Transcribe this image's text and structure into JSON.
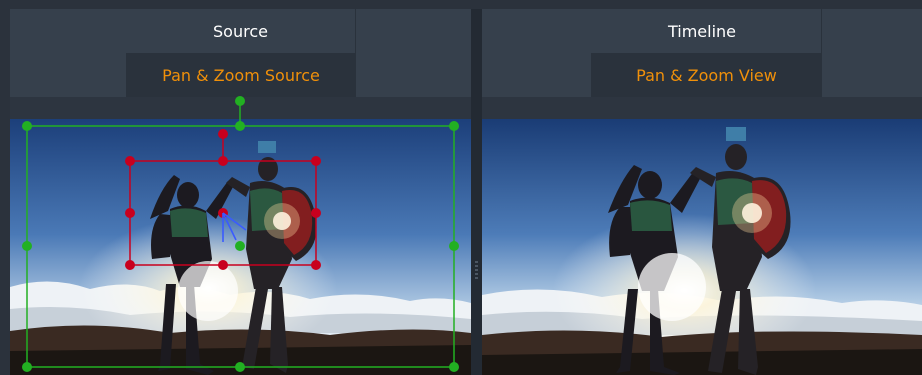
{
  "source_panel": {
    "title": "Source",
    "tab_label": "Pan & Zoom Source"
  },
  "timeline_panel": {
    "title": "Timeline",
    "tab_label": "Pan & Zoom View"
  },
  "colors": {
    "tab_text": "#f0900a",
    "source_frame": "#22b022",
    "zoom_frame": "#c8001e",
    "motion_arrow": "#3a5bff",
    "panel_bg": "#36404c"
  },
  "icons": [
    "source-frame-handle",
    "zoom-frame-handle",
    "motion-path-arrow"
  ]
}
